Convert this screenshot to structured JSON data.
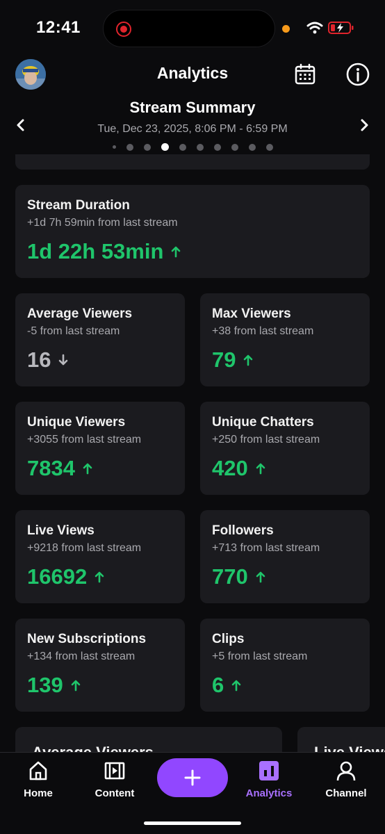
{
  "status_bar": {
    "time": "12:41"
  },
  "header": {
    "title": "Analytics"
  },
  "summary": {
    "title": "Stream Summary",
    "date_range": "Tue, Dec 23, 2025, 8:06 PM - 6:59 PM",
    "page_count": 10,
    "active_page": 3
  },
  "cards": {
    "duration": {
      "label": "Stream Duration",
      "sub": "+1d 7h 59min from last stream",
      "value": "1d 22h 53min",
      "trend": "up"
    },
    "average_viewers": {
      "label": "Average Viewers",
      "sub": "-5 from last stream",
      "value": "16",
      "trend": "down"
    },
    "max_viewers": {
      "label": "Max Viewers",
      "sub": "+38 from last stream",
      "value": "79",
      "trend": "up"
    },
    "unique_viewers": {
      "label": "Unique Viewers",
      "sub": "+3055 from last stream",
      "value": "7834",
      "trend": "up"
    },
    "unique_chatters": {
      "label": "Unique Chatters",
      "sub": "+250 from last stream",
      "value": "420",
      "trend": "up"
    },
    "live_views": {
      "label": "Live Views",
      "sub": "+9218 from last stream",
      "value": "16692",
      "trend": "up"
    },
    "followers": {
      "label": "Followers",
      "sub": "+713 from last stream",
      "value": "770",
      "trend": "up"
    },
    "new_subscriptions": {
      "label": "New Subscriptions",
      "sub": "+134 from last stream",
      "value": "139",
      "trend": "up"
    },
    "clips": {
      "label": "Clips",
      "sub": "+5 from last stream",
      "value": "6",
      "trend": "up"
    }
  },
  "bottom_cards": [
    {
      "label": "Average Viewers"
    },
    {
      "label": "Live Views"
    }
  ],
  "tabs": [
    {
      "label": "Home",
      "icon": "home-icon"
    },
    {
      "label": "Content",
      "icon": "film-icon"
    },
    {
      "label": "Analytics",
      "icon": "bar-chart-icon",
      "active": true
    },
    {
      "label": "Channel",
      "icon": "person-icon"
    }
  ],
  "colors": {
    "accent": "#9147ff",
    "positive": "#1fc56b",
    "card": "#1b1b1f",
    "background": "#0b0b0d"
  }
}
